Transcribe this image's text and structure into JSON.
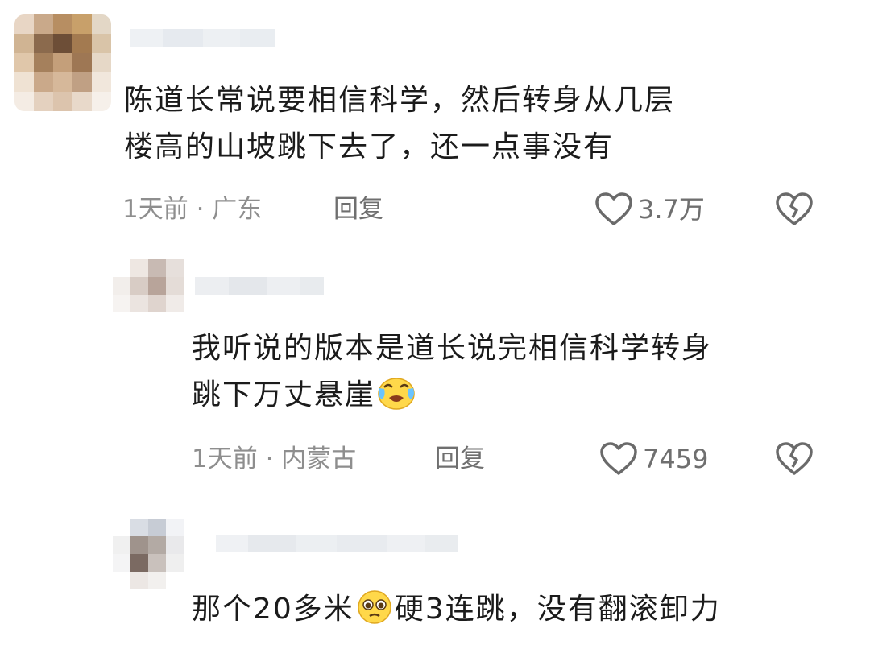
{
  "comments": [
    {
      "text_line1": "陈道长常说要相信科学，然后转身从几层",
      "text_line2": "楼高的山坡跳下去了，还一点事没有",
      "meta": "1天前 · 广东",
      "reply_label": "回复",
      "likes": "3.7万"
    }
  ],
  "replies": [
    {
      "text_line1": "我听说的版本是道长说完相信科学转身",
      "text_line2": "跳下万丈悬崖",
      "emoji": "crying-face",
      "meta": "1天前 · 内蒙古",
      "reply_label": "回复",
      "likes": "7459"
    },
    {
      "text_part1": "那个20多米",
      "emoji": "pleading-face",
      "text_part2": "硬3连跳，没有翻滚卸力"
    }
  ]
}
